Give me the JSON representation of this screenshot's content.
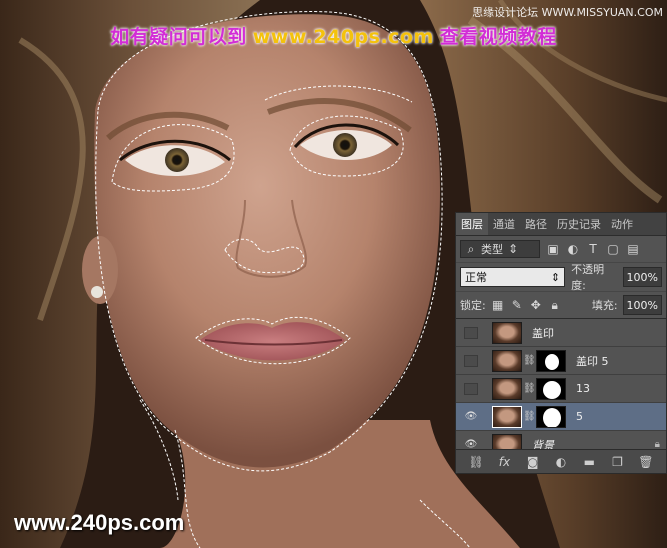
{
  "banner": {
    "part1": "如有疑问可以到",
    "part2": "www.240ps.com",
    "part3": "查看视频教程"
  },
  "credit": "思缘设计论坛 WWW.MISSYUAN.COM",
  "footer_url": "www.240ps.com",
  "panel": {
    "tabs": [
      "图层",
      "通道",
      "路径",
      "历史记录",
      "动作"
    ],
    "active_tab": "图层",
    "kind_label": "类型",
    "blend_mode": "正常",
    "opacity_label": "不透明度:",
    "opacity_value": "100%",
    "lock_label": "锁定:",
    "fill_label": "填充:",
    "fill_value": "100%",
    "layers": [
      {
        "name": "盖印",
        "visible": false,
        "mask": false,
        "selected": false
      },
      {
        "name": "盖印 5",
        "visible": false,
        "mask": true,
        "selected": false
      },
      {
        "name": "13",
        "visible": false,
        "mask": true,
        "selected": false
      },
      {
        "name": "5",
        "visible": true,
        "mask": true,
        "selected": true
      },
      {
        "name": "背景",
        "visible": true,
        "mask": false,
        "selected": false,
        "locked": true
      }
    ]
  },
  "colors": {
    "banner_magenta": "#d22dd6",
    "banner_yellow": "#f4c20d",
    "panel_bg": "#535353",
    "selected_layer": "#5e6e86"
  }
}
